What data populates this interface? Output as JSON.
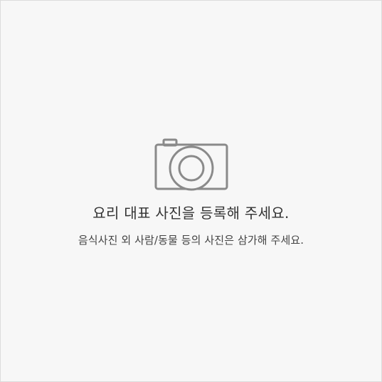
{
  "upload": {
    "icon": "camera-icon",
    "icon_color": "#8a8a8a",
    "background_color": "#f7f7f7",
    "main_text": "요리 대표 사진을 등록해 주세요.",
    "sub_text": "음식사진 외 사람/동물 등의 사진은 삼가해 주세요."
  }
}
